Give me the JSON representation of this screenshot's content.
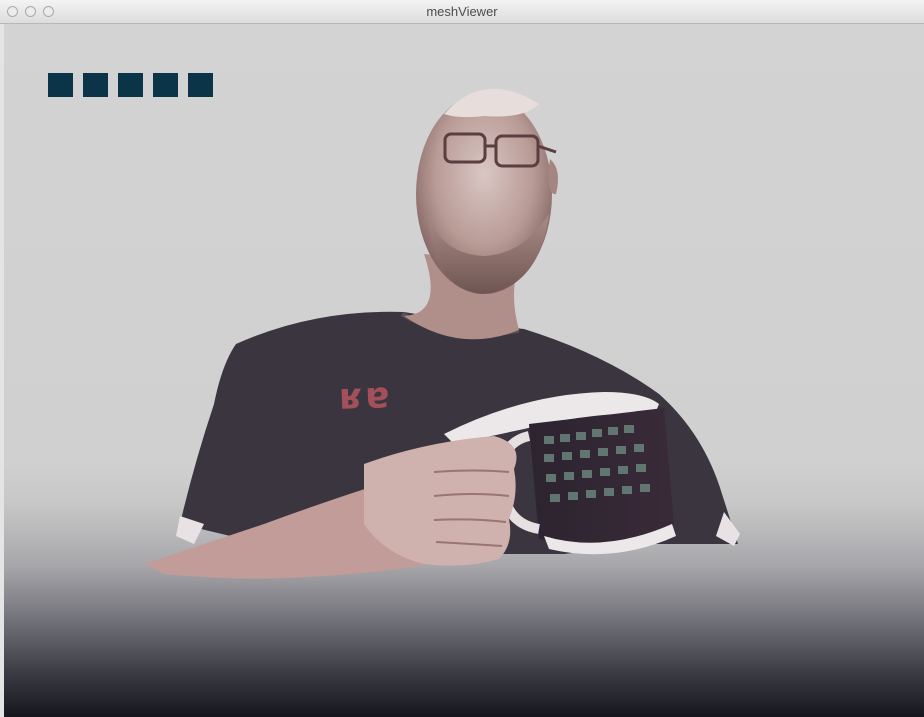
{
  "window": {
    "title": "meshViewer"
  },
  "loading": {
    "segments_filled": 5
  },
  "shirt": {
    "text": "ʁɐ"
  },
  "colors": {
    "indicator": "#0c3448",
    "background_top": "#d3d3d3",
    "background_bottom": "#16161d",
    "shirt": "#3a3540"
  }
}
